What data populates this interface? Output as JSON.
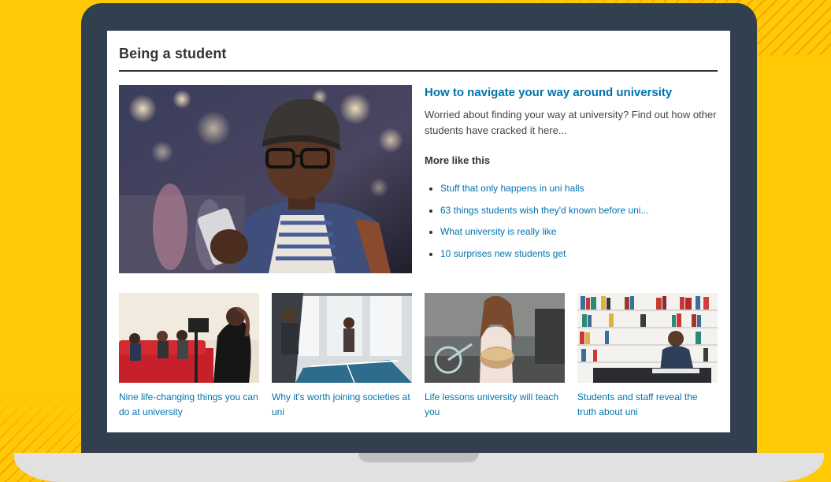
{
  "section": {
    "title": "Being a student"
  },
  "hero": {
    "title": "How to navigate your way around university",
    "description": "Worried about finding your way at university? Find out how other students have cracked it here...",
    "more_title": "More like this",
    "more_links": [
      "Stuff that only happens in uni halls",
      "63 things students wish they'd known before uni...",
      "What university is really like",
      "10 surprises new students get"
    ]
  },
  "cards": [
    {
      "caption": "Nine life-changing things you can do at university"
    },
    {
      "caption": "Why it's worth joining societies at uni"
    },
    {
      "caption": "Life lessons university will teach you"
    },
    {
      "caption": "Students and staff reveal the truth about uni"
    }
  ],
  "colors": {
    "background": "#FFC905",
    "stripe": "#F5A20A",
    "laptop_frame": "#323F4E",
    "laptop_base": "#E1E1E1",
    "link": "#0073AE",
    "heading": "#333333"
  }
}
